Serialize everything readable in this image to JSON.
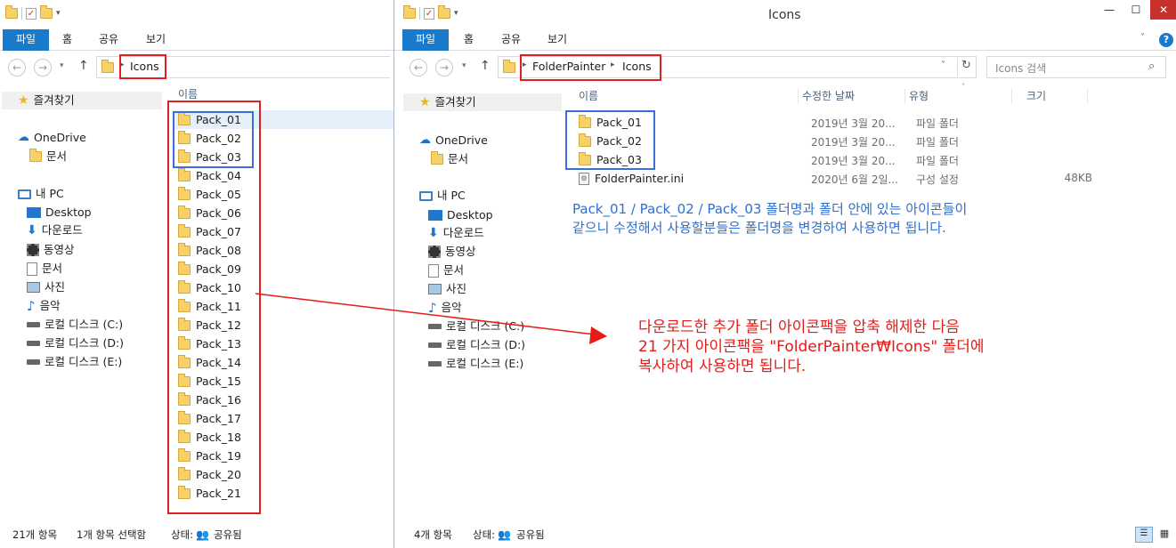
{
  "left_window": {
    "ribbon_tabs": [
      "파일",
      "홈",
      "공유",
      "보기"
    ],
    "address": "Icons",
    "column_header": "이름",
    "nav": {
      "favorites": "즐겨찾기",
      "onedrive": "OneDrive",
      "onedrive_docs": "문서",
      "this_pc": "내 PC",
      "desktop": "Desktop",
      "downloads": "다운로드",
      "videos": "동영상",
      "documents": "문서",
      "pictures": "사진",
      "music": "음악",
      "disk_c": "로컬 디스크 (C:)",
      "disk_d": "로컬 디스크 (D:)",
      "disk_e": "로컬 디스크 (E:)"
    },
    "files": [
      "Pack_01",
      "Pack_02",
      "Pack_03",
      "Pack_04",
      "Pack_05",
      "Pack_06",
      "Pack_07",
      "Pack_08",
      "Pack_09",
      "Pack_10",
      "Pack_11",
      "Pack_12",
      "Pack_13",
      "Pack_14",
      "Pack_15",
      "Pack_16",
      "Pack_17",
      "Pack_18",
      "Pack_19",
      "Pack_20",
      "Pack_21"
    ],
    "status": {
      "count": "21개 항목",
      "selected": "1개 항목 선택함",
      "state_label": "상태:",
      "state_value": "공유됨"
    }
  },
  "right_window": {
    "title": "Icons",
    "ribbon_tabs": [
      "파일",
      "홈",
      "공유",
      "보기"
    ],
    "breadcrumb": [
      "FolderPainter",
      "Icons"
    ],
    "search_placeholder": "Icons 검색",
    "columns": {
      "name": "이름",
      "modified": "수정한 날짜",
      "type": "유형",
      "size": "크기"
    },
    "nav": {
      "favorites": "즐겨찾기",
      "onedrive": "OneDrive",
      "onedrive_docs": "문서",
      "this_pc": "내 PC",
      "desktop": "Desktop",
      "downloads": "다운로드",
      "videos": "동영상",
      "documents": "문서",
      "pictures": "사진",
      "music": "음악",
      "disk_c": "로컬 디스크 (C:)",
      "disk_d": "로컬 디스크 (D:)",
      "disk_e": "로컬 디스크 (E:)"
    },
    "files": [
      {
        "name": "Pack_01",
        "modified": "2019년 3월 20...",
        "type": "파일 폴더",
        "size": ""
      },
      {
        "name": "Pack_02",
        "modified": "2019년 3월 20...",
        "type": "파일 폴더",
        "size": ""
      },
      {
        "name": "Pack_03",
        "modified": "2019년 3월 20...",
        "type": "파일 폴더",
        "size": ""
      },
      {
        "name": "FolderPainter.ini",
        "modified": "2020년 6월 2일...",
        "type": "구성 설정",
        "size": "48KB"
      }
    ],
    "status": {
      "count": "4개 항목",
      "state_label": "상태:",
      "state_value": "공유됨"
    }
  },
  "annotations": {
    "blue_line1": "Pack_01 / Pack_02 / Pack_03 폴더명과 폴더 안에 있는 아이콘들이",
    "blue_line2": "같으니 수정해서 사용할분들은 폴더명을 변경하여 사용하면 됩니다.",
    "red_line1": "다운로드한 추가 폴더 아이콘팩을 압축 해제한 다음",
    "red_line2": "21 가지 아이콘팩을 \"FolderPainter₩Icons\" 폴더에",
    "red_line3": "복사하여 사용하면 됩니다."
  },
  "colors": {
    "accent": "#1979ca",
    "red_annotation": "#e41b17",
    "blue_annotation": "#2f6fd0"
  }
}
